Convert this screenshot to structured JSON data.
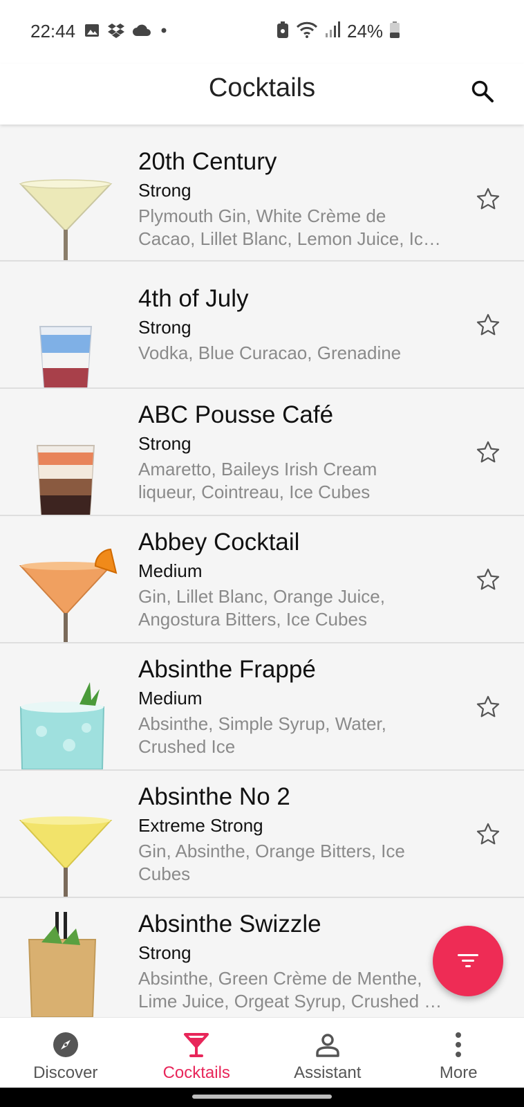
{
  "status": {
    "time": "22:44",
    "battery": "24%",
    "left_icons": [
      "gallery-icon",
      "dropbox-icon",
      "cloud-icon",
      "dot-icon"
    ],
    "right_icons": [
      "lock-battery-icon",
      "wifi-icon",
      "signal-icon",
      "battery-icon"
    ]
  },
  "app_bar": {
    "title": "Cocktails",
    "search_icon": "search-icon"
  },
  "cocktails": [
    {
      "name": "20th Century",
      "strength": "Strong",
      "ingredients_line1": "Plymouth Gin, White Crème de",
      "ingredients_line2": "Cacao, Lillet Blanc, Lemon Juice, Ic…",
      "drink_color": "#ece9b8"
    },
    {
      "name": "4th of July",
      "strength": "Strong",
      "ingredients_line1": "Vodka, Blue Curacao, Grenadine",
      "ingredients_line2": "",
      "drink_color": "#b5d3ee"
    },
    {
      "name": "ABC Pousse Café",
      "strength": "Strong",
      "ingredients_line1": "Amaretto, Baileys Irish Cream",
      "ingredients_line2": "liqueur, Cointreau, Ice Cubes",
      "drink_color": "#e8845a"
    },
    {
      "name": "Abbey Cocktail",
      "strength": "Medium",
      "ingredients_line1": "Gin, Lillet Blanc, Orange Juice,",
      "ingredients_line2": "Angostura Bitters, Ice Cubes",
      "drink_color": "#f0a060"
    },
    {
      "name": "Absinthe Frappé",
      "strength": "Medium",
      "ingredients_line1": "Absinthe, Simple Syrup, Water,",
      "ingredients_line2": "Crushed Ice",
      "drink_color": "#9fe0de"
    },
    {
      "name": "Absinthe No 2",
      "strength": "Extreme Strong",
      "ingredients_line1": "Gin, Absinthe, Orange Bitters, Ice",
      "ingredients_line2": "Cubes",
      "drink_color": "#f2e36a"
    },
    {
      "name": "Absinthe Swizzle",
      "strength": "Strong",
      "ingredients_line1": "Absinthe, Green Crème de Menthe,",
      "ingredients_line2": "Lime Juice, Orgeat Syrup, Crushed …",
      "drink_color": "#d9b070"
    }
  ],
  "fab": {
    "icon": "filter-icon"
  },
  "bottom_nav": [
    {
      "label": "Discover",
      "icon": "compass-icon"
    },
    {
      "label": "Cocktails",
      "icon": "cocktail-glass-icon",
      "active": true
    },
    {
      "label": "Assistant",
      "icon": "person-icon"
    },
    {
      "label": "More",
      "icon": "more-vertical-icon"
    }
  ],
  "colors": {
    "accent": "#ee2c55",
    "active_nav": "#e8265a"
  }
}
